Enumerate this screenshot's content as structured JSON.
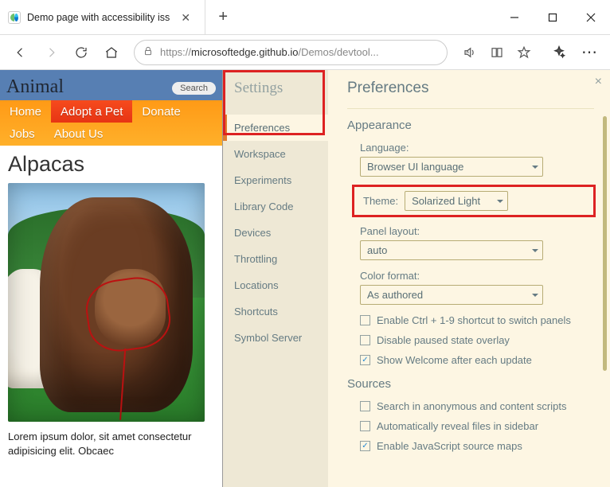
{
  "browser": {
    "tab_title": "Demo page with accessibility iss",
    "url_prefix": "https://",
    "url_main": "microsoftedge.github.io",
    "url_path": "/Demos/devtool..."
  },
  "page": {
    "brand": "Animal",
    "search_placeholder": "Search",
    "nav": [
      "Home",
      "Adopt a Pet",
      "Donate",
      "Jobs",
      "About Us"
    ],
    "nav_active_index": 1,
    "heading": "Alpacas",
    "lorem": "Lorem ipsum dolor, sit amet consectetur adipisicing elit. Obcaec"
  },
  "devtools": {
    "title": "Settings",
    "close": "×",
    "sidebar": [
      "Preferences",
      "Workspace",
      "Experiments",
      "Library Code",
      "Devices",
      "Throttling",
      "Locations",
      "Shortcuts",
      "Symbol Server"
    ],
    "sidebar_active_index": 0,
    "pane_title": "Preferences",
    "appearance": {
      "heading": "Appearance",
      "language_label": "Language:",
      "language_value": "Browser UI language",
      "theme_label": "Theme:",
      "theme_value": "Solarized Light",
      "panel_label": "Panel layout:",
      "panel_value": "auto",
      "color_label": "Color format:",
      "color_value": "As authored",
      "checks": [
        {
          "label": "Enable Ctrl + 1-9 shortcut to switch panels",
          "checked": false
        },
        {
          "label": "Disable paused state overlay",
          "checked": false
        },
        {
          "label": "Show Welcome after each update",
          "checked": true
        }
      ]
    },
    "sources": {
      "heading": "Sources",
      "checks": [
        {
          "label": "Search in anonymous and content scripts",
          "checked": false
        },
        {
          "label": "Automatically reveal files in sidebar",
          "checked": false
        },
        {
          "label": "Enable JavaScript source maps",
          "checked": true
        }
      ]
    }
  }
}
